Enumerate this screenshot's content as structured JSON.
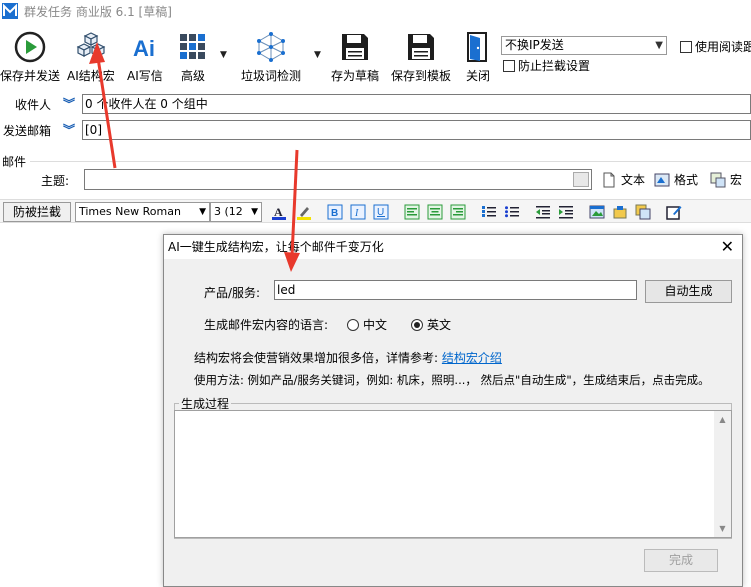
{
  "window": {
    "title": "群发任务 商业版 6.1 [草稿]"
  },
  "toolbar": {
    "buttons": [
      {
        "label": "保存并发送",
        "icon": "play-icon"
      },
      {
        "label": "AI结构宏",
        "icon": "cubes-icon"
      },
      {
        "label": "AI写信",
        "icon": "ai-icon"
      },
      {
        "label": "高级",
        "icon": "grid-icon"
      },
      {
        "label": "垃圾词检测",
        "icon": "network-icon"
      },
      {
        "label": "存为草稿",
        "icon": "floppy-icon"
      },
      {
        "label": "保存到模板",
        "icon": "floppy-template-icon"
      },
      {
        "label": "关闭",
        "icon": "door-icon"
      }
    ],
    "ip_select": "不换IP发送",
    "use_read_receipt": "使用阅读跟",
    "anti_block": "防止拦截设置"
  },
  "fields": {
    "recipients_label": "收件人",
    "recipients_value": "0 个收件人在 0 个组中",
    "sender_label": "发送邮箱",
    "sender_value": "[0]"
  },
  "mail": {
    "group_label": "邮件",
    "subject_label": "主题:",
    "subject_value": "",
    "text_btn": "文本",
    "format_btn": "格式",
    "macro_btn": "宏"
  },
  "format": {
    "anti_block_btn": "防被拦截",
    "font_name": "Times New Roman",
    "font_size": "3 (12"
  },
  "dialog": {
    "title": "AI一键生成结构宏，让每个邮件千变万化",
    "product_label": "产品/服务:",
    "product_value": "led",
    "auto_btn": "自动生成",
    "lang_label": "生成邮件宏内容的语言:",
    "lang_cn": "中文",
    "lang_en": "英文",
    "lang_selected": "英文",
    "info_text": "结构宏将会使营销效果增加很多倍，详情参考:",
    "info_link": "结构宏介绍",
    "usage_text": "使用方法: 例如产品/服务关键词，例如: 机床，照明...， 然后点\"自动生成\"，生成结束后，点击完成。",
    "process_label": "生成过程",
    "process_value": "",
    "done_btn": "完成"
  },
  "colors": {
    "accent_link": "#0066cc",
    "arrow_red": "#e8392c",
    "icon_blue": "#1a6fd0"
  }
}
